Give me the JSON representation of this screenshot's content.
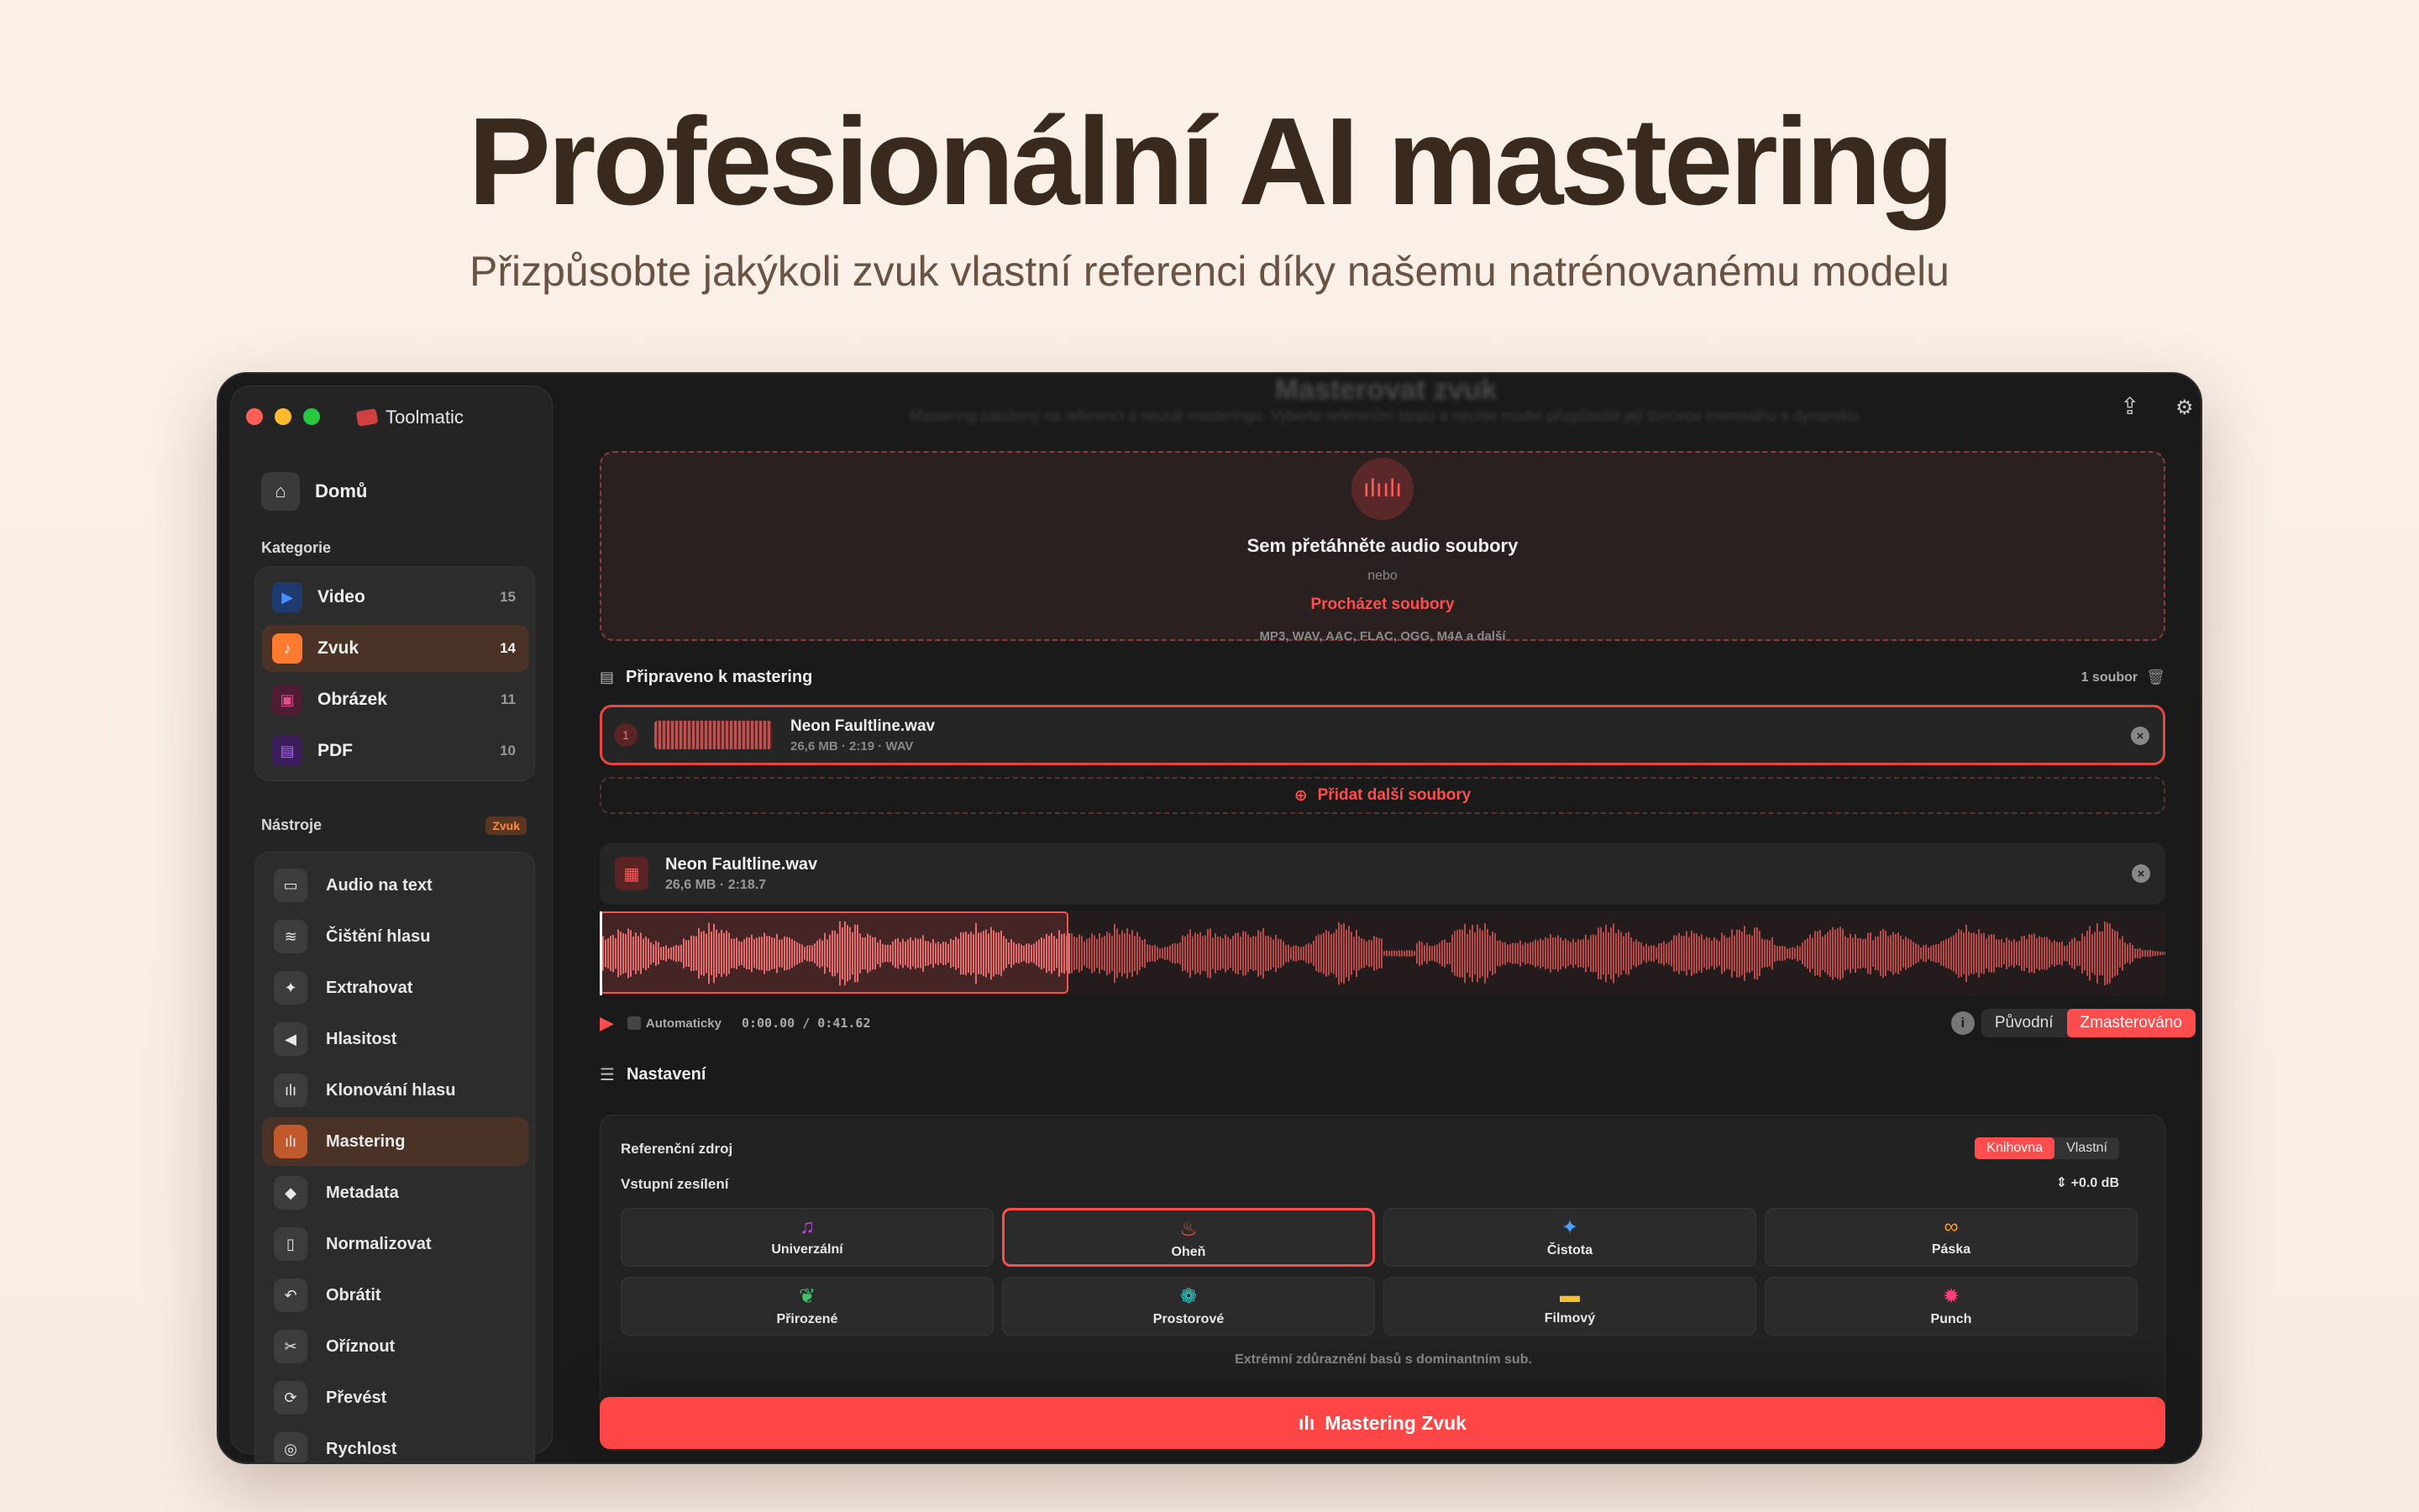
{
  "hero": {
    "title": "Profesionální AI mastering",
    "subtitle": "Přizpůsobte jakýkoli zvuk vlastní referenci díky našemu natrénovanému modelu"
  },
  "app": {
    "name": "Toolmatic",
    "ghost_title": "Masterovat zvuk",
    "ghost_subtitle": "Mastering založený na referenci a neurál masteringu. Vyberte referenční stopu a nechte model přizpůsobit její tónovou rovnováhu a dynamiku."
  },
  "sidebar": {
    "home_label": "Domů",
    "categories_label": "Kategorie",
    "categories": [
      {
        "label": "Video",
        "count": "15",
        "icon": "video-icon",
        "color": "#2f6fd6"
      },
      {
        "label": "Zvuk",
        "count": "14",
        "icon": "music-note-icon",
        "color": "#ff7a2f"
      },
      {
        "label": "Obrázek",
        "count": "11",
        "icon": "image-icon",
        "color": "#c0306a"
      },
      {
        "label": "PDF",
        "count": "10",
        "icon": "pdf-icon",
        "color": "#7a2fc0"
      }
    ],
    "tools_label": "Nástroje",
    "tools_badge": "Zvuk",
    "tools": [
      {
        "label": "Audio na text",
        "icon": "speech-bubble-icon"
      },
      {
        "label": "Čištění hlasu",
        "icon": "waveform-clean-icon"
      },
      {
        "label": "Extrahovat",
        "icon": "extract-icon"
      },
      {
        "label": "Hlasitost",
        "icon": "speaker-icon"
      },
      {
        "label": "Klonování hlasu",
        "icon": "voice-clone-icon"
      },
      {
        "label": "Mastering",
        "icon": "mastering-icon"
      },
      {
        "label": "Metadata",
        "icon": "tag-icon"
      },
      {
        "label": "Normalizovat",
        "icon": "normalize-icon"
      },
      {
        "label": "Obrátit",
        "icon": "reverse-icon"
      },
      {
        "label": "Oříznout",
        "icon": "scissors-icon"
      },
      {
        "label": "Převést",
        "icon": "convert-icon"
      },
      {
        "label": "Rychlost",
        "icon": "speed-icon"
      }
    ]
  },
  "dropzone": {
    "title": "Sem přetáhněte audio soubory",
    "or": "nebo",
    "browse": "Procházet soubory",
    "formats": "MP3, WAV, AAC, FLAC, OGG, M4A a další"
  },
  "queue": {
    "label": "Připraveno k mastering",
    "count": "1 soubor",
    "file": {
      "index": "1",
      "name": "Neon Faultline.wav",
      "meta": "26,6 MB · 2:19 · WAV"
    },
    "add_more": "Přidat další soubory"
  },
  "player": {
    "name": "Neon Faultline.wav",
    "meta": "26,6 MB  ·  2:18.7",
    "auto_label": "Automaticky",
    "time": "0:00.00 / 0:41.62",
    "original_label": "Původní",
    "mastered_label": "Zmasterováno"
  },
  "settings": {
    "label": "Nastavení",
    "ref_source_label": "Referenční zdroj",
    "ref_library": "Knihovna",
    "ref_custom": "Vlastní",
    "input_gain_label": "Vstupní zesílení",
    "input_gain_value": "+0.0 dB",
    "presets": [
      {
        "label": "Univerzální",
        "icon": "music-notes-icon",
        "color": "#c04adf"
      },
      {
        "label": "Oheň",
        "icon": "fire-icon",
        "color": "#ff4d4d"
      },
      {
        "label": "Čistota",
        "icon": "sparkle-icon",
        "color": "#4aa0ff"
      },
      {
        "label": "Páska",
        "icon": "cassette-icon",
        "color": "#ff9a2f"
      },
      {
        "label": "Přirozené",
        "icon": "leaf-icon",
        "color": "#3ec46a"
      },
      {
        "label": "Prostorové",
        "icon": "flower-icon",
        "color": "#2fd0d0"
      },
      {
        "label": "Filmový",
        "icon": "film-icon",
        "color": "#f2c230"
      },
      {
        "label": "Punch",
        "icon": "burst-icon",
        "color": "#ff3d7a"
      }
    ],
    "preset_description": "Extrémní zdůraznění basů s dominantním sub."
  },
  "action": {
    "master_button": "Mastering Zvuk"
  }
}
